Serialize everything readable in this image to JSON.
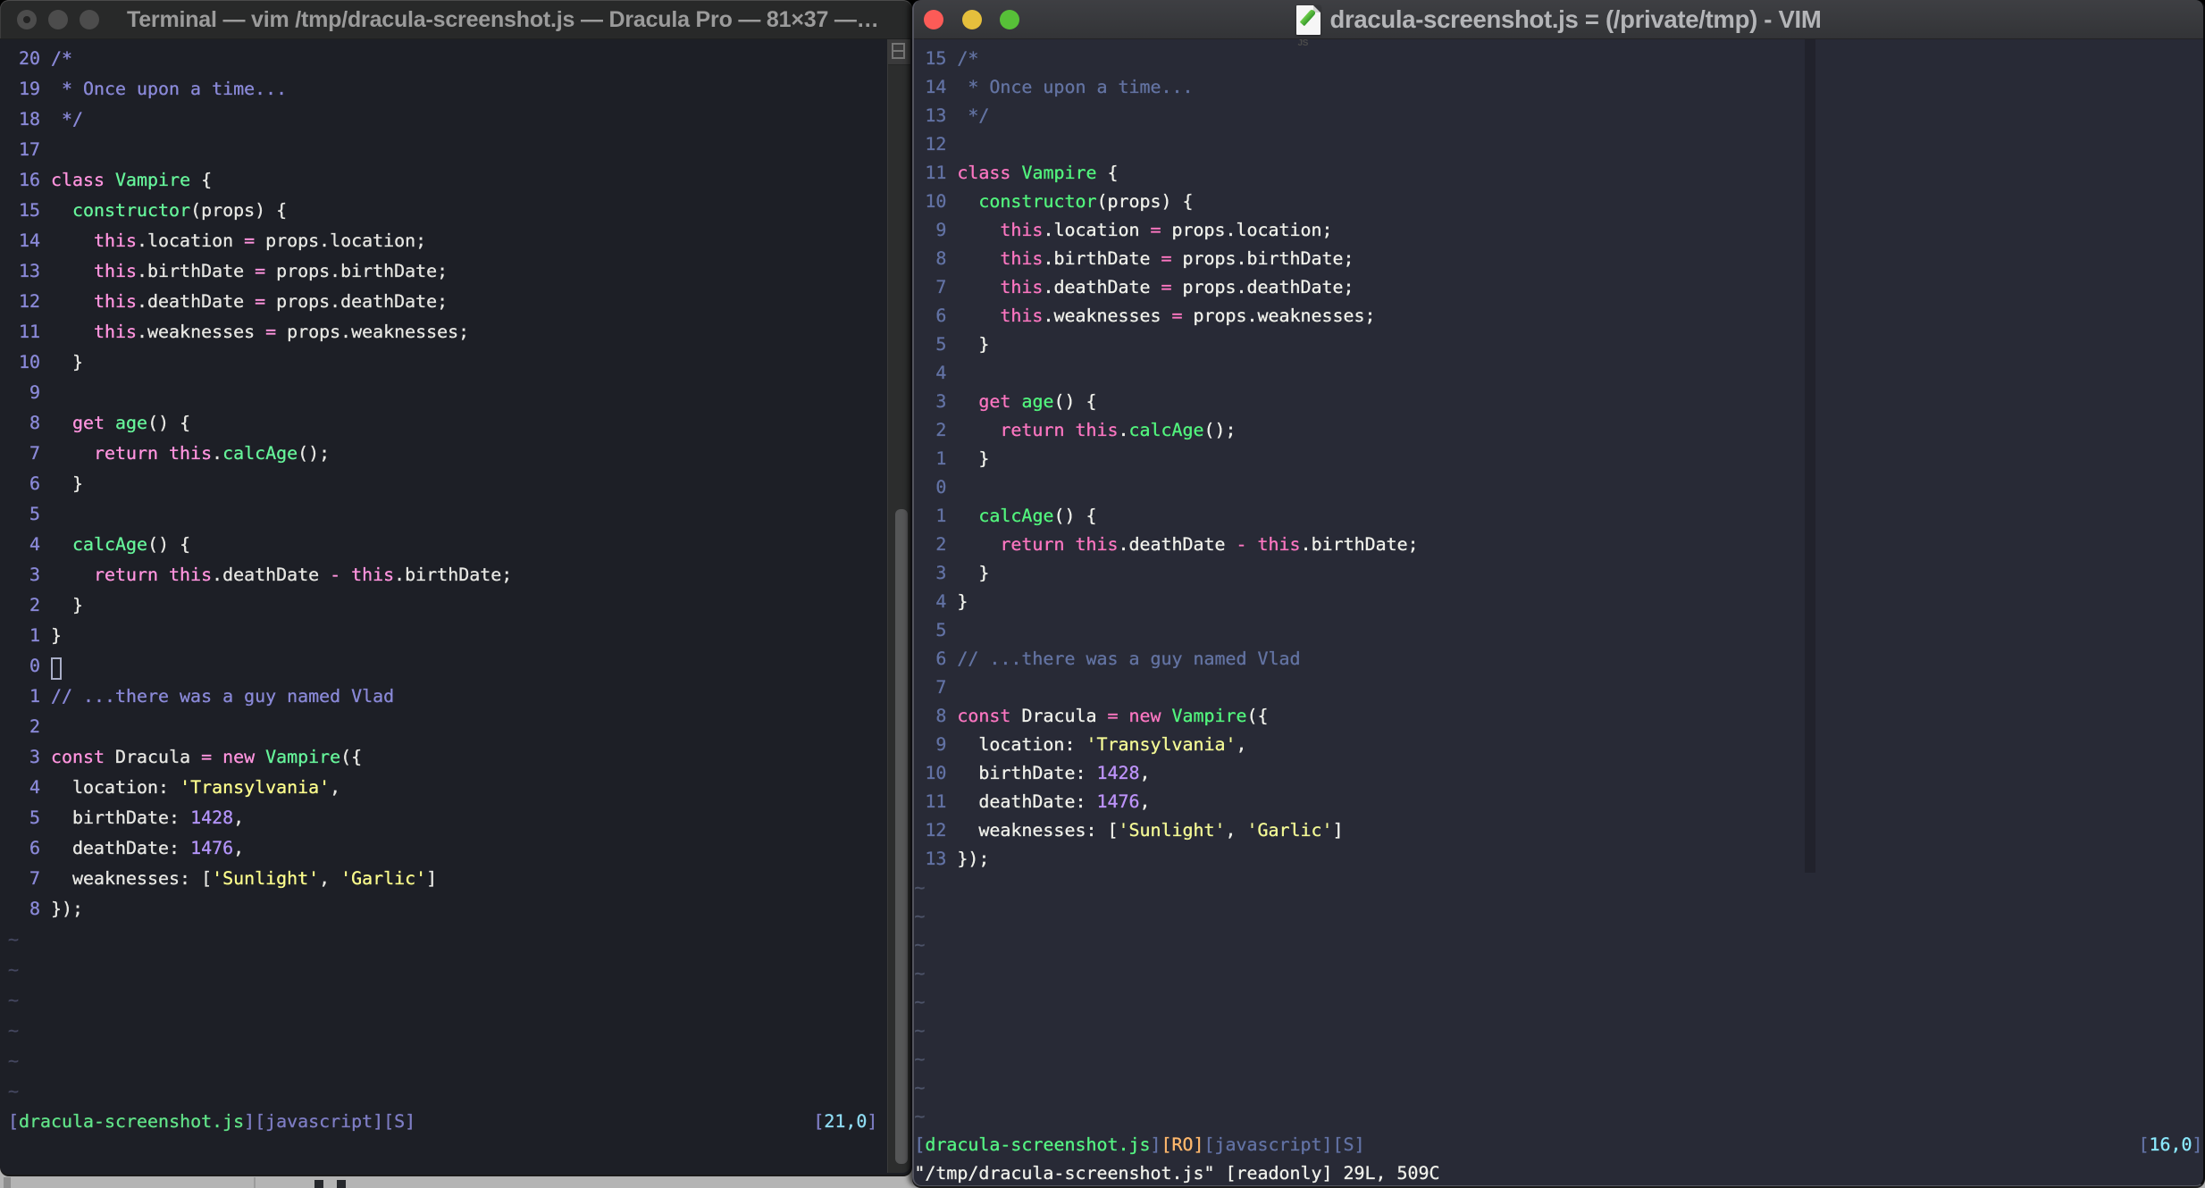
{
  "desktop": {
    "background_color": "#b4b4b4"
  },
  "terminal_window": {
    "title": "Terminal — vim /tmp/dracula-screenshot.js — Dracula Pro — 81×37 —…",
    "grid_size": "81×37",
    "traffic_lights": [
      "close-modified",
      "minimize",
      "zoom"
    ],
    "colors": {
      "background": "#1d1f26",
      "line_number": "#8b8ad6",
      "comment": "#8b8ad6",
      "keyword_pink": "#ff80bf",
      "function_green": "#59f68d",
      "foreground": "#e9e9e6",
      "string_yellow": "#f1fa8c",
      "number_purple": "#bd93f9",
      "status_green": "#62de84",
      "status_blue": "#7a7fd0",
      "cyan": "#8be9fd",
      "tilde": "#6a6db0"
    },
    "rows": [
      {
        "n": "20",
        "t": [
          [
            "c",
            "/*"
          ]
        ]
      },
      {
        "n": "19",
        "t": [
          [
            "c",
            " * Once upon a time..."
          ]
        ]
      },
      {
        "n": "18",
        "t": [
          [
            "c",
            " */"
          ]
        ]
      },
      {
        "n": "17",
        "t": []
      },
      {
        "n": "16",
        "t": [
          [
            "k",
            "class "
          ],
          [
            "g",
            "Vampire"
          ],
          [
            "w",
            " {"
          ]
        ]
      },
      {
        "n": "15",
        "t": [
          [
            "w",
            "  "
          ],
          [
            "g",
            "constructor"
          ],
          [
            "w",
            "(props) {"
          ]
        ]
      },
      {
        "n": "14",
        "t": [
          [
            "w",
            "    "
          ],
          [
            "k",
            "this"
          ],
          [
            "w",
            ".location "
          ],
          [
            "k",
            "="
          ],
          [
            "w",
            " props.location;"
          ]
        ]
      },
      {
        "n": "13",
        "t": [
          [
            "w",
            "    "
          ],
          [
            "k",
            "this"
          ],
          [
            "w",
            ".birthDate "
          ],
          [
            "k",
            "="
          ],
          [
            "w",
            " props.birthDate;"
          ]
        ]
      },
      {
        "n": "12",
        "t": [
          [
            "w",
            "    "
          ],
          [
            "k",
            "this"
          ],
          [
            "w",
            ".deathDate "
          ],
          [
            "k",
            "="
          ],
          [
            "w",
            " props.deathDate;"
          ]
        ]
      },
      {
        "n": "11",
        "t": [
          [
            "w",
            "    "
          ],
          [
            "k",
            "this"
          ],
          [
            "w",
            ".weaknesses "
          ],
          [
            "k",
            "="
          ],
          [
            "w",
            " props.weaknesses;"
          ]
        ]
      },
      {
        "n": "10",
        "t": [
          [
            "w",
            "  }"
          ]
        ]
      },
      {
        "n": "9",
        "t": []
      },
      {
        "n": "8",
        "t": [
          [
            "w",
            "  "
          ],
          [
            "k",
            "get "
          ],
          [
            "g",
            "age"
          ],
          [
            "w",
            "() {"
          ]
        ]
      },
      {
        "n": "7",
        "t": [
          [
            "w",
            "    "
          ],
          [
            "k",
            "return this"
          ],
          [
            "w",
            "."
          ],
          [
            "g",
            "calcAge"
          ],
          [
            "w",
            "();"
          ]
        ]
      },
      {
        "n": "6",
        "t": [
          [
            "w",
            "  }"
          ]
        ]
      },
      {
        "n": "5",
        "t": []
      },
      {
        "n": "4",
        "t": [
          [
            "w",
            "  "
          ],
          [
            "g",
            "calcAge"
          ],
          [
            "w",
            "() {"
          ]
        ]
      },
      {
        "n": "3",
        "t": [
          [
            "w",
            "    "
          ],
          [
            "k",
            "return this"
          ],
          [
            "w",
            ".deathDate "
          ],
          [
            "k",
            "-"
          ],
          [
            "w",
            " "
          ],
          [
            "k",
            "this"
          ],
          [
            "w",
            ".birthDate;"
          ]
        ]
      },
      {
        "n": "2",
        "t": [
          [
            "w",
            "  }"
          ]
        ]
      },
      {
        "n": "1",
        "t": [
          [
            "w",
            "}"
          ]
        ]
      },
      {
        "n": "0",
        "t": [],
        "cursor": true
      },
      {
        "n": "1",
        "t": [
          [
            "c",
            "// ...there was a guy named Vlad"
          ]
        ]
      },
      {
        "n": "2",
        "t": []
      },
      {
        "n": "3",
        "t": [
          [
            "k",
            "const "
          ],
          [
            "w",
            "Dracula "
          ],
          [
            "k",
            "= new "
          ],
          [
            "g",
            "Vampire"
          ],
          [
            "w",
            "({"
          ]
        ]
      },
      {
        "n": "4",
        "t": [
          [
            "w",
            "  location: "
          ],
          [
            "y",
            "'Transylvania'"
          ],
          [
            "w",
            ","
          ]
        ]
      },
      {
        "n": "5",
        "t": [
          [
            "w",
            "  birthDate: "
          ],
          [
            "p",
            "1428"
          ],
          [
            "w",
            ","
          ]
        ]
      },
      {
        "n": "6",
        "t": [
          [
            "w",
            "  deathDate: "
          ],
          [
            "p",
            "1476"
          ],
          [
            "w",
            ","
          ]
        ]
      },
      {
        "n": "7",
        "t": [
          [
            "w",
            "  weaknesses: ["
          ],
          [
            "y",
            "'Sunlight'"
          ],
          [
            "w",
            ", "
          ],
          [
            "y",
            "'Garlic'"
          ],
          [
            "w",
            "]"
          ]
        ]
      },
      {
        "n": "8",
        "t": [
          [
            "w",
            "});"
          ]
        ]
      },
      {
        "tilde": true
      },
      {
        "tilde": true
      },
      {
        "tilde": true
      },
      {
        "tilde": true
      },
      {
        "tilde": true
      },
      {
        "tilde": true
      },
      {
        "status": {
          "left": [
            [
              "b",
              "["
            ],
            [
              "sg",
              "dracula-screenshot.js"
            ],
            [
              "b",
              "][javascript][S]"
            ]
          ],
          "right": [
            [
              "b",
              "["
            ],
            [
              "cy",
              "21,0"
            ],
            [
              "b",
              "]"
            ]
          ]
        }
      },
      {
        "cmd": []
      }
    ]
  },
  "macvim_window": {
    "title": "dracula-screenshot.js = (/private/tmp) - VIM",
    "file_icon": "js-document-icon",
    "traffic_lights": [
      "close",
      "minimize",
      "zoom"
    ],
    "colors": {
      "background": "#282a36",
      "colorcolumn": "#21222c",
      "line_number": "#5c6694",
      "comment": "#6373a2",
      "keyword_pink": "#ff79c6",
      "function_green": "#50fa7b",
      "foreground": "#f2f2f0",
      "string_yellow": "#f1fa8c",
      "number_purple": "#bd93f9",
      "status_green": "#5af78e",
      "status_blue": "#6272a4",
      "orange": "#ffb86c",
      "cyan": "#8be9fd",
      "tilde": "#556084"
    },
    "rows": [
      {
        "n": "15",
        "t": [
          [
            "c",
            "/*"
          ]
        ]
      },
      {
        "n": "14",
        "t": [
          [
            "c",
            " * Once upon a time..."
          ]
        ]
      },
      {
        "n": "13",
        "t": [
          [
            "c",
            " */"
          ]
        ]
      },
      {
        "n": "12",
        "t": []
      },
      {
        "n": "11",
        "t": [
          [
            "k",
            "class "
          ],
          [
            "g",
            "Vampire"
          ],
          [
            "w",
            " {"
          ]
        ]
      },
      {
        "n": "10",
        "t": [
          [
            "w",
            "  "
          ],
          [
            "g",
            "constructor"
          ],
          [
            "w",
            "(props) {"
          ]
        ]
      },
      {
        "n": "9",
        "t": [
          [
            "w",
            "    "
          ],
          [
            "k",
            "this"
          ],
          [
            "w",
            ".location "
          ],
          [
            "k",
            "="
          ],
          [
            "w",
            " props.location;"
          ]
        ]
      },
      {
        "n": "8",
        "t": [
          [
            "w",
            "    "
          ],
          [
            "k",
            "this"
          ],
          [
            "w",
            ".birthDate "
          ],
          [
            "k",
            "="
          ],
          [
            "w",
            " props.birthDate;"
          ]
        ]
      },
      {
        "n": "7",
        "t": [
          [
            "w",
            "    "
          ],
          [
            "k",
            "this"
          ],
          [
            "w",
            ".deathDate "
          ],
          [
            "k",
            "="
          ],
          [
            "w",
            " props.deathDate;"
          ]
        ]
      },
      {
        "n": "6",
        "t": [
          [
            "w",
            "    "
          ],
          [
            "k",
            "this"
          ],
          [
            "w",
            ".weaknesses "
          ],
          [
            "k",
            "="
          ],
          [
            "w",
            " props.weaknesses;"
          ]
        ]
      },
      {
        "n": "5",
        "t": [
          [
            "w",
            "  }"
          ]
        ]
      },
      {
        "n": "4",
        "t": []
      },
      {
        "n": "3",
        "t": [
          [
            "w",
            "  "
          ],
          [
            "k",
            "get "
          ],
          [
            "g",
            "age"
          ],
          [
            "w",
            "() {"
          ]
        ]
      },
      {
        "n": "2",
        "t": [
          [
            "w",
            "    "
          ],
          [
            "k",
            "return this"
          ],
          [
            "w",
            "."
          ],
          [
            "g",
            "calcAge"
          ],
          [
            "w",
            "();"
          ]
        ]
      },
      {
        "n": "1",
        "t": [
          [
            "w",
            "  }"
          ]
        ]
      },
      {
        "n": "0",
        "t": []
      },
      {
        "n": "1",
        "t": [
          [
            "w",
            "  "
          ],
          [
            "g",
            "calcAge"
          ],
          [
            "w",
            "() {"
          ]
        ]
      },
      {
        "n": "2",
        "t": [
          [
            "w",
            "    "
          ],
          [
            "k",
            "return this"
          ],
          [
            "w",
            ".deathDate "
          ],
          [
            "k",
            "-"
          ],
          [
            "w",
            " "
          ],
          [
            "k",
            "this"
          ],
          [
            "w",
            ".birthDate;"
          ]
        ]
      },
      {
        "n": "3",
        "t": [
          [
            "w",
            "  }"
          ]
        ]
      },
      {
        "n": "4",
        "t": [
          [
            "w",
            "}"
          ]
        ]
      },
      {
        "n": "5",
        "t": []
      },
      {
        "n": "6",
        "t": [
          [
            "c",
            "// ...there was a guy named Vlad"
          ]
        ]
      },
      {
        "n": "7",
        "t": []
      },
      {
        "n": "8",
        "t": [
          [
            "k",
            "const "
          ],
          [
            "w",
            "Dracula "
          ],
          [
            "k",
            "= new "
          ],
          [
            "g",
            "Vampire"
          ],
          [
            "w",
            "({"
          ]
        ]
      },
      {
        "n": "9",
        "t": [
          [
            "w",
            "  location: "
          ],
          [
            "y",
            "'Transylvania'"
          ],
          [
            "w",
            ","
          ]
        ]
      },
      {
        "n": "10",
        "t": [
          [
            "w",
            "  birthDate: "
          ],
          [
            "p",
            "1428"
          ],
          [
            "w",
            ","
          ]
        ]
      },
      {
        "n": "11",
        "t": [
          [
            "w",
            "  deathDate: "
          ],
          [
            "p",
            "1476"
          ],
          [
            "w",
            ","
          ]
        ]
      },
      {
        "n": "12",
        "t": [
          [
            "w",
            "  weaknesses: ["
          ],
          [
            "y",
            "'Sunlight'"
          ],
          [
            "w",
            ", "
          ],
          [
            "y",
            "'Garlic'"
          ],
          [
            "w",
            "]"
          ]
        ]
      },
      {
        "n": "13",
        "t": [
          [
            "w",
            "});"
          ]
        ]
      },
      {
        "tilde": true
      },
      {
        "tilde": true
      },
      {
        "tilde": true
      },
      {
        "tilde": true
      },
      {
        "tilde": true
      },
      {
        "tilde": true
      },
      {
        "tilde": true
      },
      {
        "tilde": true
      },
      {
        "tilde": true
      },
      {
        "status": {
          "left": [
            [
              "b",
              "["
            ],
            [
              "sg",
              "dracula-screenshot.js"
            ],
            [
              "b",
              "]"
            ],
            [
              "o",
              "[RO]"
            ],
            [
              "b",
              "[javascript][S]"
            ]
          ],
          "right": [
            [
              "b",
              "["
            ],
            [
              "cy",
              "16,0"
            ],
            [
              "b",
              "]"
            ]
          ]
        }
      },
      {
        "cmd": [
          [
            "w",
            "\"/tmp/dracula-screenshot.js\" [readonly] 29L, 509C"
          ]
        ]
      }
    ]
  }
}
